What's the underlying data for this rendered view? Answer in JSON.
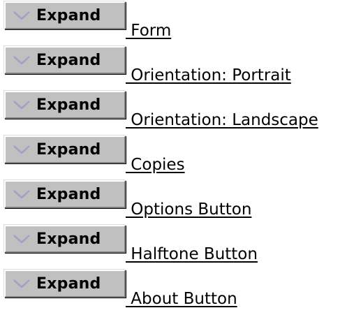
{
  "expand_button": {
    "label": "Expand",
    "icon": "chevron-down-icon",
    "icon_color": "#a0a0c0",
    "face_color": "#c0c0c0"
  },
  "items": [
    {
      "expand_label": "Expand",
      "link_text": " Form"
    },
    {
      "expand_label": "Expand",
      "link_text": " Orientation: Portrait"
    },
    {
      "expand_label": "Expand",
      "link_text": " Orientation: Landscape"
    },
    {
      "expand_label": "Expand",
      "link_text": " Copies"
    },
    {
      "expand_label": "Expand",
      "link_text": " Options Button"
    },
    {
      "expand_label": "Expand",
      "link_text": " Halftone Button"
    },
    {
      "expand_label": "Expand",
      "link_text": " About Button"
    }
  ]
}
